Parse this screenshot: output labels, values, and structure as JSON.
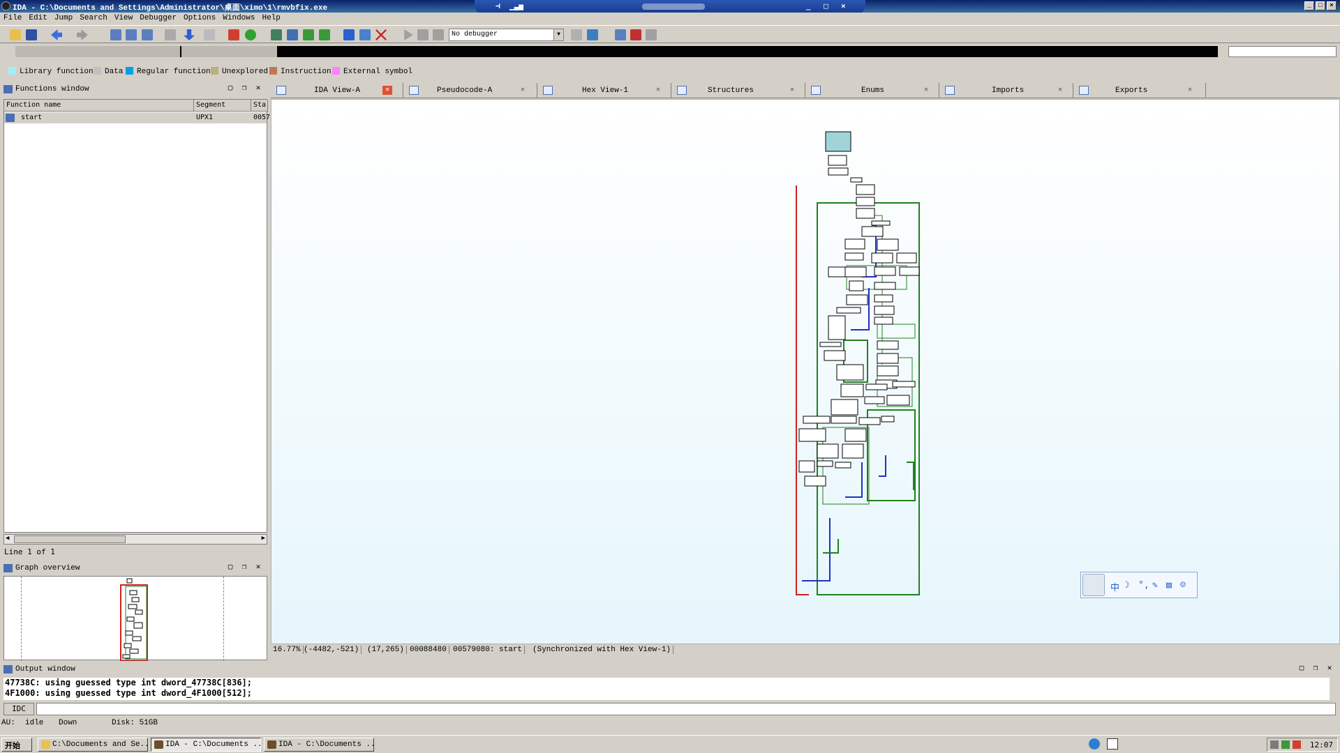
{
  "window": {
    "title": "IDA - C:\\Documents and Settings\\Administrator\\桌面\\ximo\\1\\rmvbfix.exe",
    "controls": [
      "_",
      "□",
      "×"
    ]
  },
  "remote_bar": {
    "controls": [
      "_",
      "□",
      "×"
    ]
  },
  "menu": [
    "File",
    "Edit",
    "Jump",
    "Search",
    "View",
    "Debugger",
    "Options",
    "Windows",
    "Help"
  ],
  "toolbar": {
    "debugger": "No debugger",
    "icons": [
      "open-icon",
      "save-icon",
      "back-icon",
      "forward-icon",
      "search-icon",
      "graph-icon",
      "run-icon",
      "pause-icon",
      "stop-icon"
    ]
  },
  "legend": [
    {
      "label": "Library function",
      "color": "#a0f0ff"
    },
    {
      "label": "Data",
      "color": "#c0c0c0"
    },
    {
      "label": "Regular function",
      "color": "#00a0e6"
    },
    {
      "label": "Unexplored",
      "color": "#b8b080"
    },
    {
      "label": "Instruction",
      "color": "#c07850"
    },
    {
      "label": "External symbol",
      "color": "#ff80ff"
    }
  ],
  "functions_window": {
    "title": "Functions window",
    "columns": [
      "Function name",
      "Segment",
      "Sta"
    ],
    "rows": [
      {
        "name": "start",
        "segment": "UPX1",
        "start": "0057"
      }
    ],
    "line_info": "Line 1 of 1"
  },
  "graph_overview": {
    "title": "Graph overview"
  },
  "tabs": [
    {
      "label": "IDA View-A",
      "active": true
    },
    {
      "label": "Pseudocode-A"
    },
    {
      "label": "Hex View-1"
    },
    {
      "label": "Structures"
    },
    {
      "label": "Enums"
    },
    {
      "label": "Imports"
    },
    {
      "label": "Exports"
    }
  ],
  "graph_status": {
    "zoom": "16.77%",
    "coords": "(-4482,-521)",
    "pos": "(17,265)",
    "offset": "00088480",
    "address": "00579080: start",
    "sync": "(Synchronized with Hex View-1)"
  },
  "qq_bar": {
    "glyphs": [
      "中",
      "☽",
      "°,",
      "✎",
      "▤",
      "☺"
    ]
  },
  "output_window": {
    "title": "Output window",
    "lines": [
      "47738C: using guessed type int dword_47738C[836];",
      "4F1000: using guessed type int dword_4F1000[512];"
    ],
    "idc_label": "IDC"
  },
  "statusbar": {
    "au": "AU:",
    "state": "idle",
    "direction": "Down",
    "disk": "Disk: 51GB"
  },
  "taskbar": {
    "start": "开始",
    "tasks": [
      {
        "label": "C:\\Documents and Se...",
        "active": false
      },
      {
        "label": "IDA - C:\\Documents ...",
        "active": true
      },
      {
        "label": "IDA - C:\\Documents ...",
        "active": false
      }
    ],
    "clock": "12:07"
  }
}
